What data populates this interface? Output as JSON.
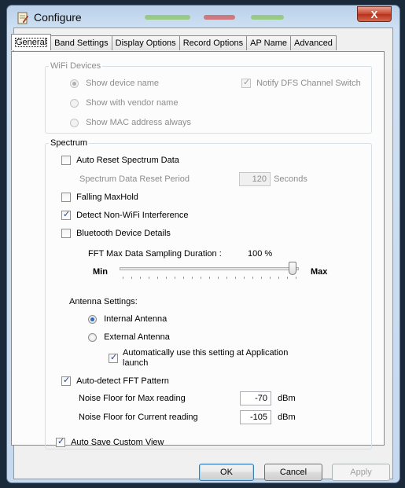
{
  "window": {
    "title": "Configure",
    "close_glyph": "X"
  },
  "tabs": [
    {
      "label": "General"
    },
    {
      "label": "Band Settings"
    },
    {
      "label": "Display Options"
    },
    {
      "label": "Record Options"
    },
    {
      "label": "AP Name"
    },
    {
      "label": "Advanced"
    }
  ],
  "wifi_devices": {
    "legend": "WiFi Devices",
    "show_device_name": "Show device name",
    "show_vendor_name": "Show with vendor name",
    "show_mac": "Show MAC address always",
    "notify_dfs": "Notify DFS Channel Switch"
  },
  "spectrum": {
    "legend": "Spectrum",
    "auto_reset": "Auto Reset Spectrum Data",
    "reset_period_label": "Spectrum Data Reset Period",
    "reset_period_value": "120",
    "reset_period_unit": "Seconds",
    "falling_maxhold": "Falling MaxHold",
    "detect_nonwifi": "Detect Non-WiFi Interference",
    "bluetooth_details": "Bluetooth Device Details",
    "fft_label": "FFT Max Data Sampling Duration :",
    "fft_value": "100 %",
    "fft_fraction": 1.0,
    "slider_min": "Min",
    "slider_max": "Max",
    "antenna_label": "Antenna Settings:",
    "internal_antenna": "Internal Antenna",
    "external_antenna": "External Antenna",
    "auto_use_line1": "Automatically use this setting at Application",
    "auto_use_line2": "launch",
    "auto_detect_fft": "Auto-detect FFT Pattern",
    "noise_max_label": "Noise Floor for Max reading",
    "noise_max_value": "-70",
    "noise_max_unit": "dBm",
    "noise_current_label": "Noise Floor for Current reading",
    "noise_current_value": "-105",
    "noise_current_unit": "dBm"
  },
  "auto_save": "Auto Save Custom View",
  "buttons": {
    "ok": "OK",
    "cancel": "Cancel",
    "apply": "Apply"
  },
  "colors": {
    "title_bar": "#b9d1ea",
    "close_red": "#c7432c",
    "radio_selected": "#2d66c7"
  }
}
